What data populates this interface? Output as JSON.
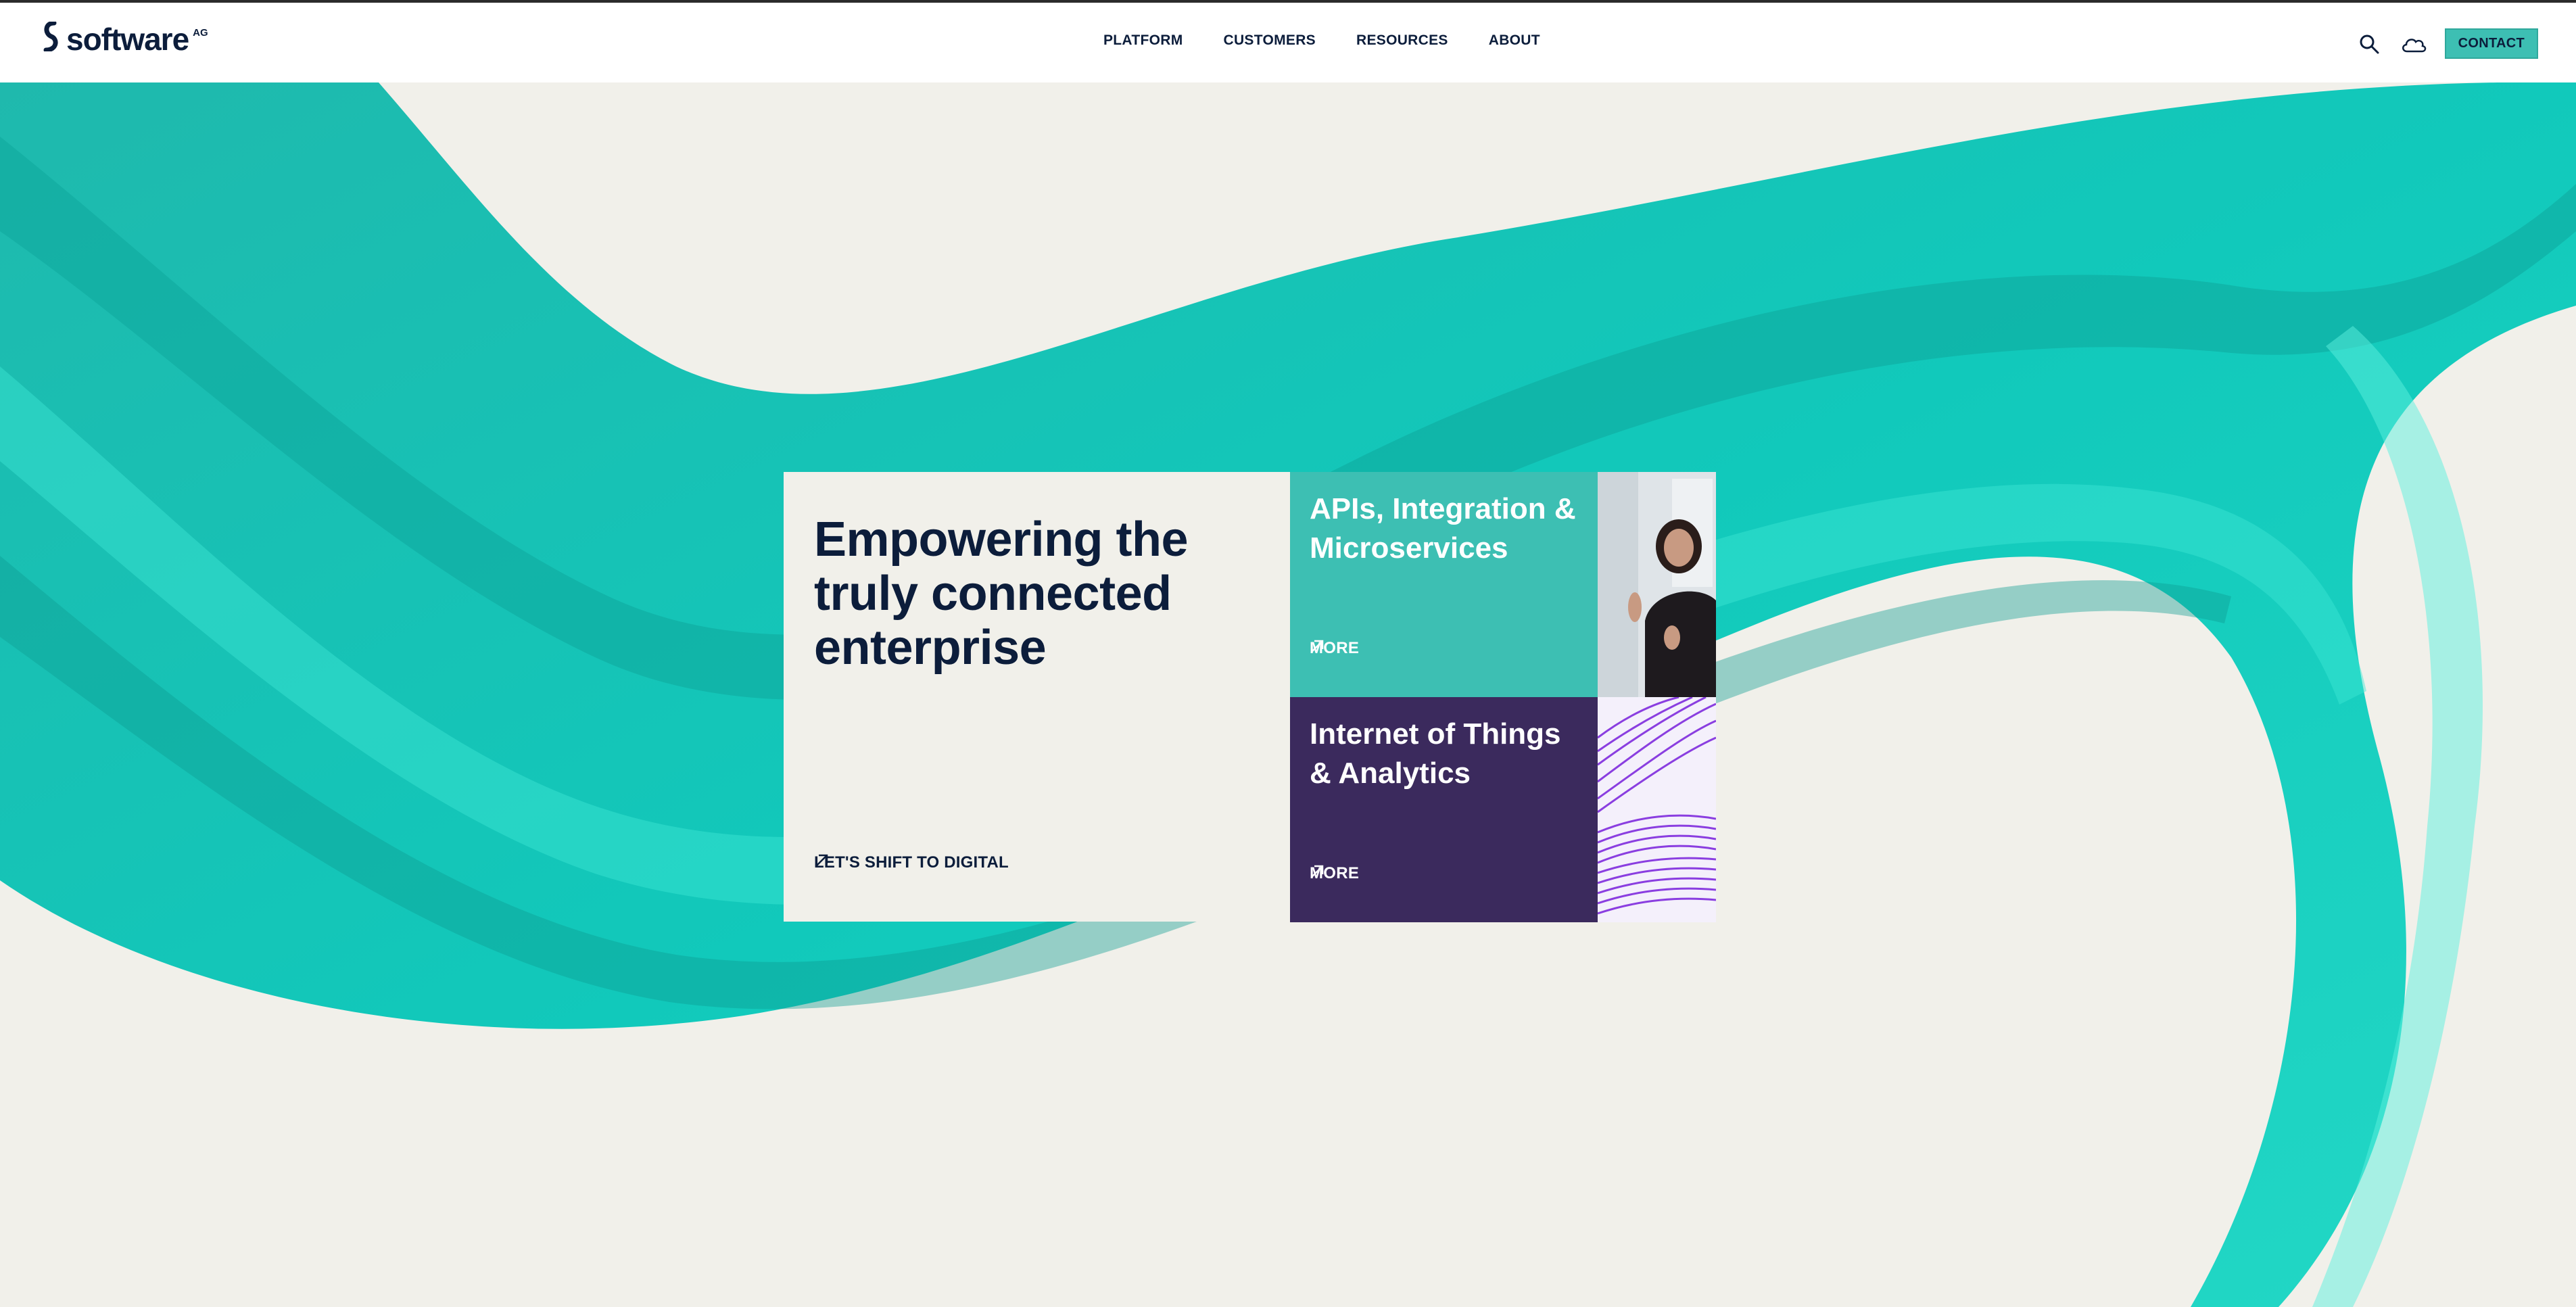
{
  "brand": {
    "name": "software",
    "suffix": "AG"
  },
  "nav": [
    "PLATFORM",
    "CUSTOMERS",
    "RESOURCES",
    "ABOUT"
  ],
  "tools": {
    "search_icon": "search-icon",
    "cloud_icon": "cloud-icon",
    "contact_label": "CONTACT"
  },
  "colors": {
    "teal": "#3dbfb3",
    "navy": "#0c1d3b",
    "purple": "#3b2a5d",
    "cream": "#f1f0ea"
  },
  "hero": {
    "headline": "Empowering the truly connected enterprise",
    "cta_label": "LET'S SHIFT TO DIGITAL"
  },
  "tiles": [
    {
      "title": "APIs, Integration & Microservices",
      "more_label": "MORE"
    },
    {
      "title": "Internet of Things & Analytics",
      "more_label": "MORE"
    }
  ]
}
